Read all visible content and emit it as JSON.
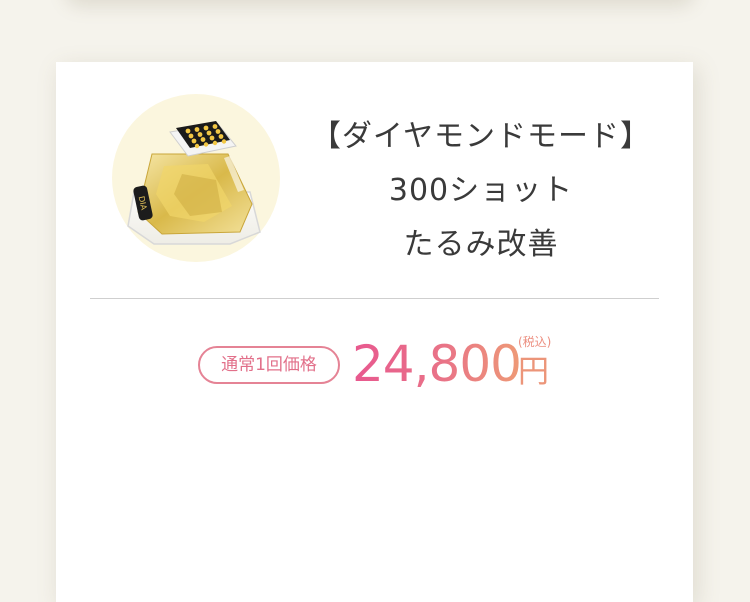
{
  "product": {
    "image_label": "DIA",
    "title_lines": [
      "【ダイヤモンドモード】",
      "300ショット",
      "たるみ改善"
    ]
  },
  "price": {
    "label": "通常1回価格",
    "amount": "24,800",
    "unit": "円",
    "tax_note": "(税込)"
  },
  "colors": {
    "page_background": "#f5f3ec",
    "card_background": "#ffffff",
    "accent_pink": "#e8588f",
    "accent_orange": "#ee9a76",
    "title_text": "#3a3a3a"
  }
}
